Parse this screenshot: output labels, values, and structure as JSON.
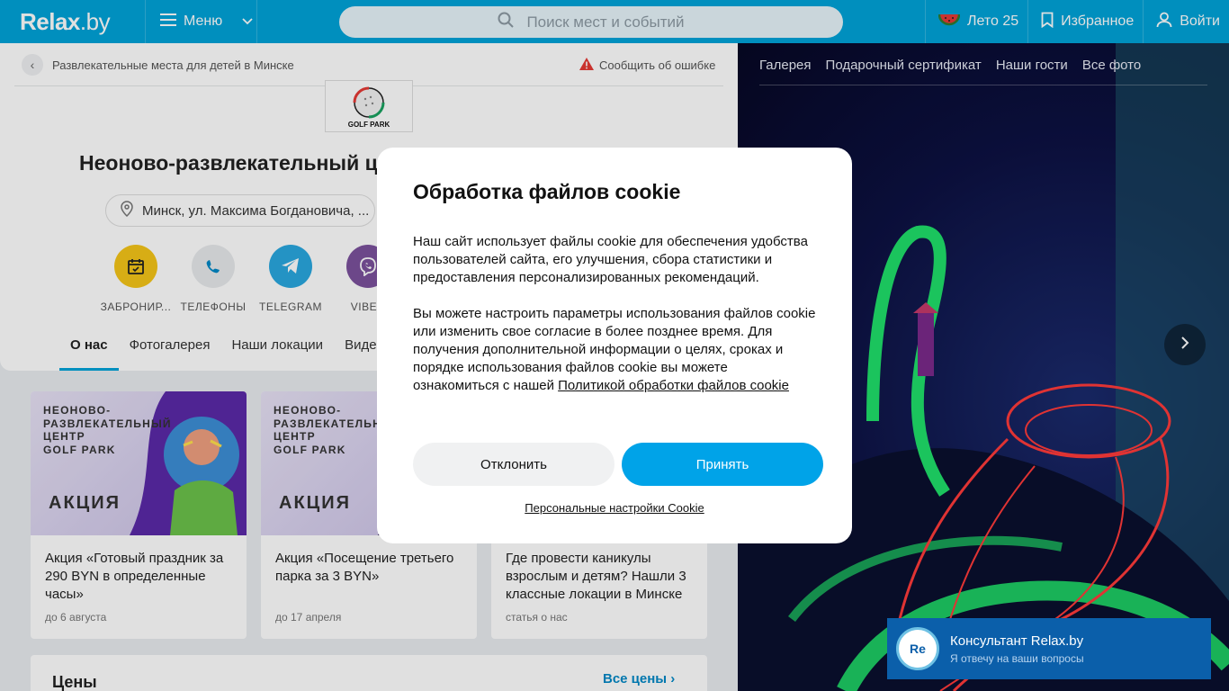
{
  "header": {
    "logo_main": "Relax",
    "logo_suffix": ".by",
    "menu_label": "Меню",
    "search_placeholder": "Поиск мест и событий",
    "summer_label": "Лето 25",
    "favorites_label": "Избранное",
    "login_label": "Войти",
    "brand_color": "#00a3d9"
  },
  "breadcrumb": {
    "text": "Развлекательные места для детей в Минске"
  },
  "report_link": "Сообщить об ошибке",
  "place": {
    "title": "Неоново-развлекательный центр Golf Park",
    "logo_text": "GOLF PARK",
    "address": "Минск, ул. Максима Богдановича, ..."
  },
  "actions": [
    {
      "label": "ЗАБРОНИР...",
      "icon": "calendar-icon",
      "color": "#f5c518"
    },
    {
      "label": "ТЕЛЕФОНЫ",
      "icon": "phone-icon",
      "color": "#e8eaec"
    },
    {
      "label": "TELEGRAM",
      "icon": "telegram-icon",
      "color": "#2aa8e0"
    },
    {
      "label": "VIBER",
      "icon": "viber-icon",
      "color": "#7b519d"
    }
  ],
  "tabs": [
    {
      "label": "О нас"
    },
    {
      "label": "Фотогалерея"
    },
    {
      "label": "Наши локации"
    },
    {
      "label": "Видео"
    }
  ],
  "cards": [
    {
      "img_text": "НЕОНОВО-\nРАЗВЛЕКАТЕЛЬНЫЙ\nЦЕНТР\nGOLF PARK",
      "badge": "АКЦИЯ",
      "title": "Акция «Готовый праздник за 290 BYN в определенные часы»",
      "meta": "до 6 августа"
    },
    {
      "img_text": "НЕОНОВО-\nРАЗВЛЕКАТЕЛЬНЫЙ\nЦЕНТР\nGOLF PARK",
      "badge": "АКЦИЯ",
      "title": "Акция «Посещение третьего парка за 3 BYN»",
      "meta": "до 17 апреля"
    },
    {
      "img_text": "",
      "badge": "",
      "title": "Где провести каникулы взрослым и детям? Нашли 3 классные локации в Минске",
      "meta": "статья о нас"
    }
  ],
  "prices": {
    "label": "Цены",
    "all_label": "Все цены"
  },
  "gallery": {
    "nav": [
      "Галерея",
      "Подарочный сертификат",
      "Наши гости",
      "Все фото"
    ]
  },
  "consultant": {
    "avatar": "Re",
    "title": "Консультант Relax.by",
    "subtitle": "Я отвечу на ваши вопросы"
  },
  "cookie_modal": {
    "title": "Обработка файлов cookie",
    "para1": "Наш сайт использует файлы cookie для обеспечения удобства пользователей сайта, его улучшения, сбора статистики и предоставления персонализированных рекомендаций.",
    "para2": "Вы можете настроить параметры использования файлов cookie или изменить свое согласие в более позднее время. Для получения дополнительной информации о целях, сроках и порядке использования файлов cookie вы можете ознакомиться с нашей",
    "policy_link": "Политикой обработки файлов cookie",
    "decline_label": "Отклонить",
    "accept_label": "Принять",
    "settings_link": "Персональные настройки Cookie"
  }
}
